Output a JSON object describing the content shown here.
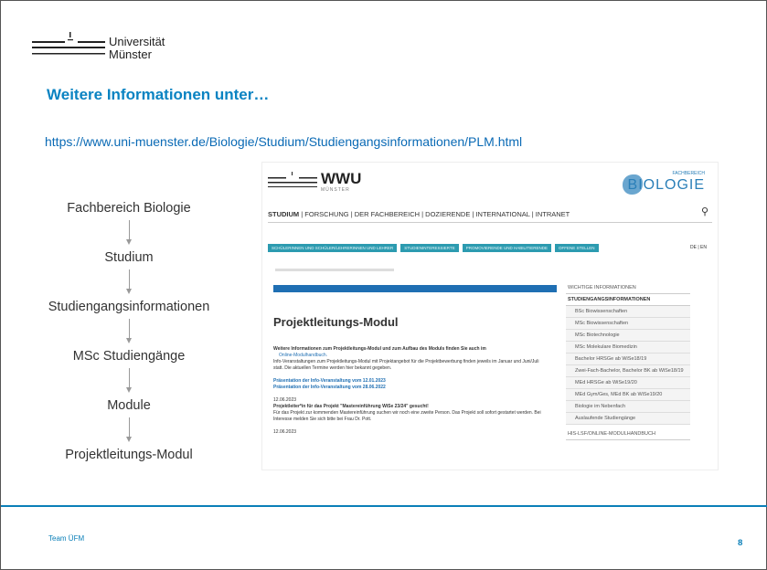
{
  "logo": {
    "line1": "Universität",
    "line2": "Münster"
  },
  "heading": "Weitere Informationen unter…",
  "url": "https://www.uni-muenster.de/Biologie/Studium/Studiengangsinformationen/PLM.html",
  "flow": [
    "Fachbereich Biologie",
    "Studium",
    "Studiengangsinformationen",
    "MSc Studiengänge",
    "Module",
    "Projektleitungs-Modul"
  ],
  "screenshot": {
    "wwu": "WWU",
    "wwu_sub": "MÜNSTER",
    "fachbereich": "FACHBEREICH",
    "biologie": "BIOLOGIE",
    "nav": [
      "STUDIUM",
      "FORSCHUNG",
      "DER FACHBEREICH",
      "DOZIERENDE",
      "INTERNATIONAL",
      "INTRANET"
    ],
    "chips": [
      "SCHÜLERINNEN UND SCHÜLER/LEHRERINNEN UND LEHRER",
      "STUDIENINTERESSIERTE",
      "PROMOVIERENDE UND HABILITIERENDE",
      "OFFENE STELLEN"
    ],
    "lang": "DE | EN",
    "page_title": "Projektleitungs-Modul",
    "intro_bold": "Weitere Informationen zum Projektleitungs-Modul und zum Aufbau des Moduls finden Sie auch im",
    "intro_link": "Online-Modulhandbuch.",
    "intro_text": "Info-Veranstaltungen zum Projektleitungs-Modul mit Projektangebot für die Projektbewerbung finden jeweils im Januar und Juni/Juli statt. Die aktuellen Termine werden hier bekannt gegeben.",
    "pres1": "Präsentation der Info-Veranstaltung vom 12.01.2023",
    "pres2": "Präsentation der Info-Veranstaltung vom 28.06.2022",
    "news_date": "12.06.2023",
    "news_title": "Projektleiter*in für das Projekt \"Mastereinführung WiSe 23/24\" gesucht!",
    "news_text": "Für das Projekt zur kommenden Mastereinführung suchen wir noch eine zweite Person. Das Projekt soll sofort gestartet werden. Bei Interesse melden Sie sich bitte bei Frau Dr. Pott.",
    "news_date2": "12.06.2023",
    "sidebar_header": "WICHTIGE INFORMATIONEN",
    "sidebar_section": "STUDIENGANGSINFORMATIONEN",
    "sidebar_items": [
      "BSc Biowissenschaften",
      "MSc Biowissenschaften",
      "MSc Biotechnologie",
      "MSc Molekulare Biomedizin",
      "Bachelor HRSGe ab WiSe18/19",
      "Zwei-Fach-Bachelor, Bachelor BK ab WiSe18/19",
      "MEd HRSGe ab WiSe19/20",
      "MEd Gym/Ges, MEd BK ab WiSe19/20",
      "Biologie im Nebenfach",
      "Auslaufende Studiengänge"
    ],
    "sidebar_footer": "HIS-LSF/ONLINE-MODULHANDBUCH"
  },
  "footer": {
    "team": "Team ÜFM",
    "page": "8"
  }
}
